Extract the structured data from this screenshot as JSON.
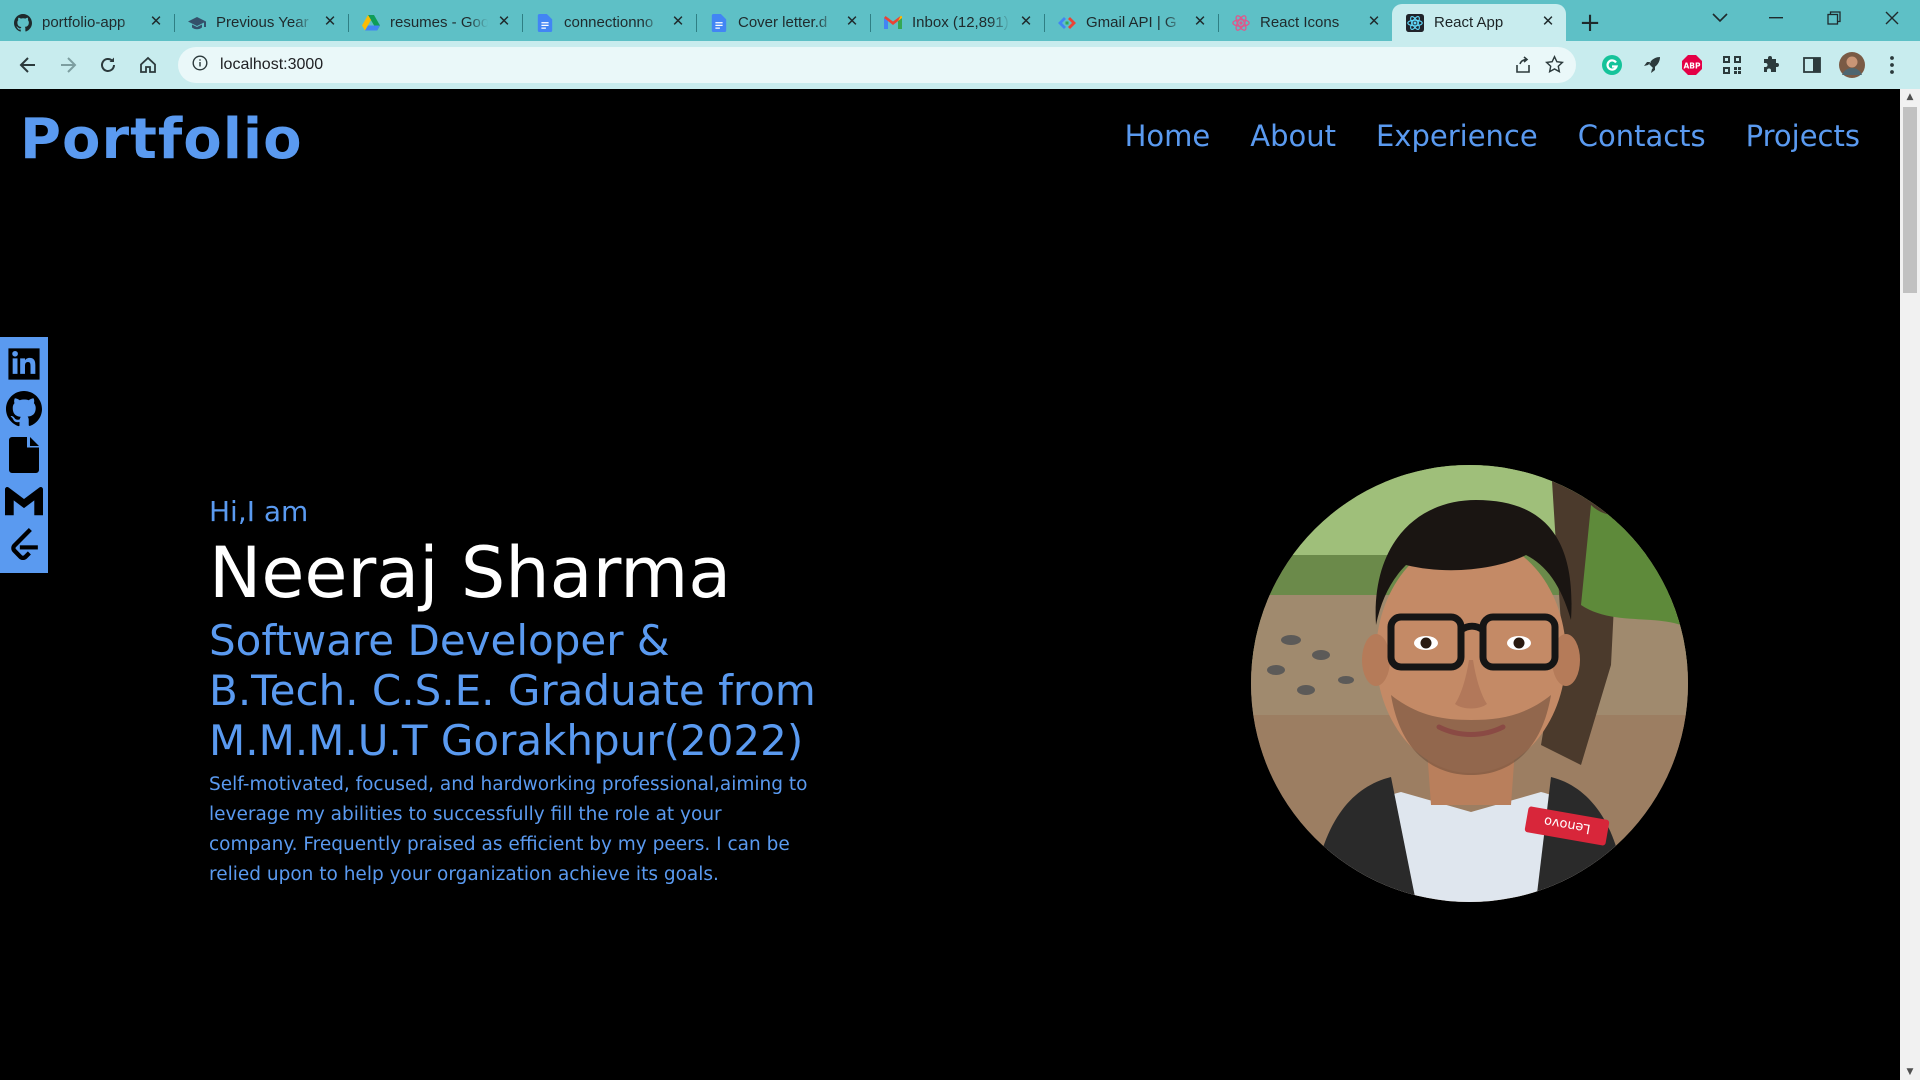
{
  "browser": {
    "tabs": [
      {
        "title": "portfolio-app",
        "icon": "github-icon"
      },
      {
        "title": "Previous Year",
        "icon": "graduation-cap-icon"
      },
      {
        "title": "resumes - Goo",
        "icon": "google-drive-icon"
      },
      {
        "title": "connectionno",
        "icon": "google-docs-icon"
      },
      {
        "title": "Cover letter.d",
        "icon": "google-docs-icon"
      },
      {
        "title": "Inbox (12,891)",
        "icon": "gmail-icon"
      },
      {
        "title": "Gmail API | G",
        "icon": "google-developers-icon"
      },
      {
        "title": "React Icons",
        "icon": "react-icons-icon"
      },
      {
        "title": "React App",
        "icon": "react-icon",
        "active": true
      }
    ],
    "url": "localhost:3000",
    "colors": {
      "tabstrip": "#5ec0c6",
      "toolbar": "#c8ecee"
    }
  },
  "site": {
    "brand": "Portfolio",
    "nav": [
      "Home",
      "About",
      "Experience",
      "Contacts",
      "Projects"
    ],
    "social": [
      "linkedin-icon",
      "github-icon",
      "resume-file-icon",
      "gmail-icon",
      "leetcode-icon"
    ],
    "accent": "#5a9af0"
  },
  "hero": {
    "greeting": "Hi,I am",
    "name": "Neeraj Sharma",
    "role_line1": "Software Developer &",
    "role_line2": "B.Tech. C.S.E. Graduate from",
    "role_line3": "M.M.M.U.T Gorakhpur(2022)",
    "bio": "Self-motivated, focused, and hardworking professional,aiming to leverage my abilities to successfully fill the role at your company. Frequently praised as efficient by my peers. I can be relied upon to help your organization achieve its goals.",
    "photo_label": "Lenovo"
  }
}
